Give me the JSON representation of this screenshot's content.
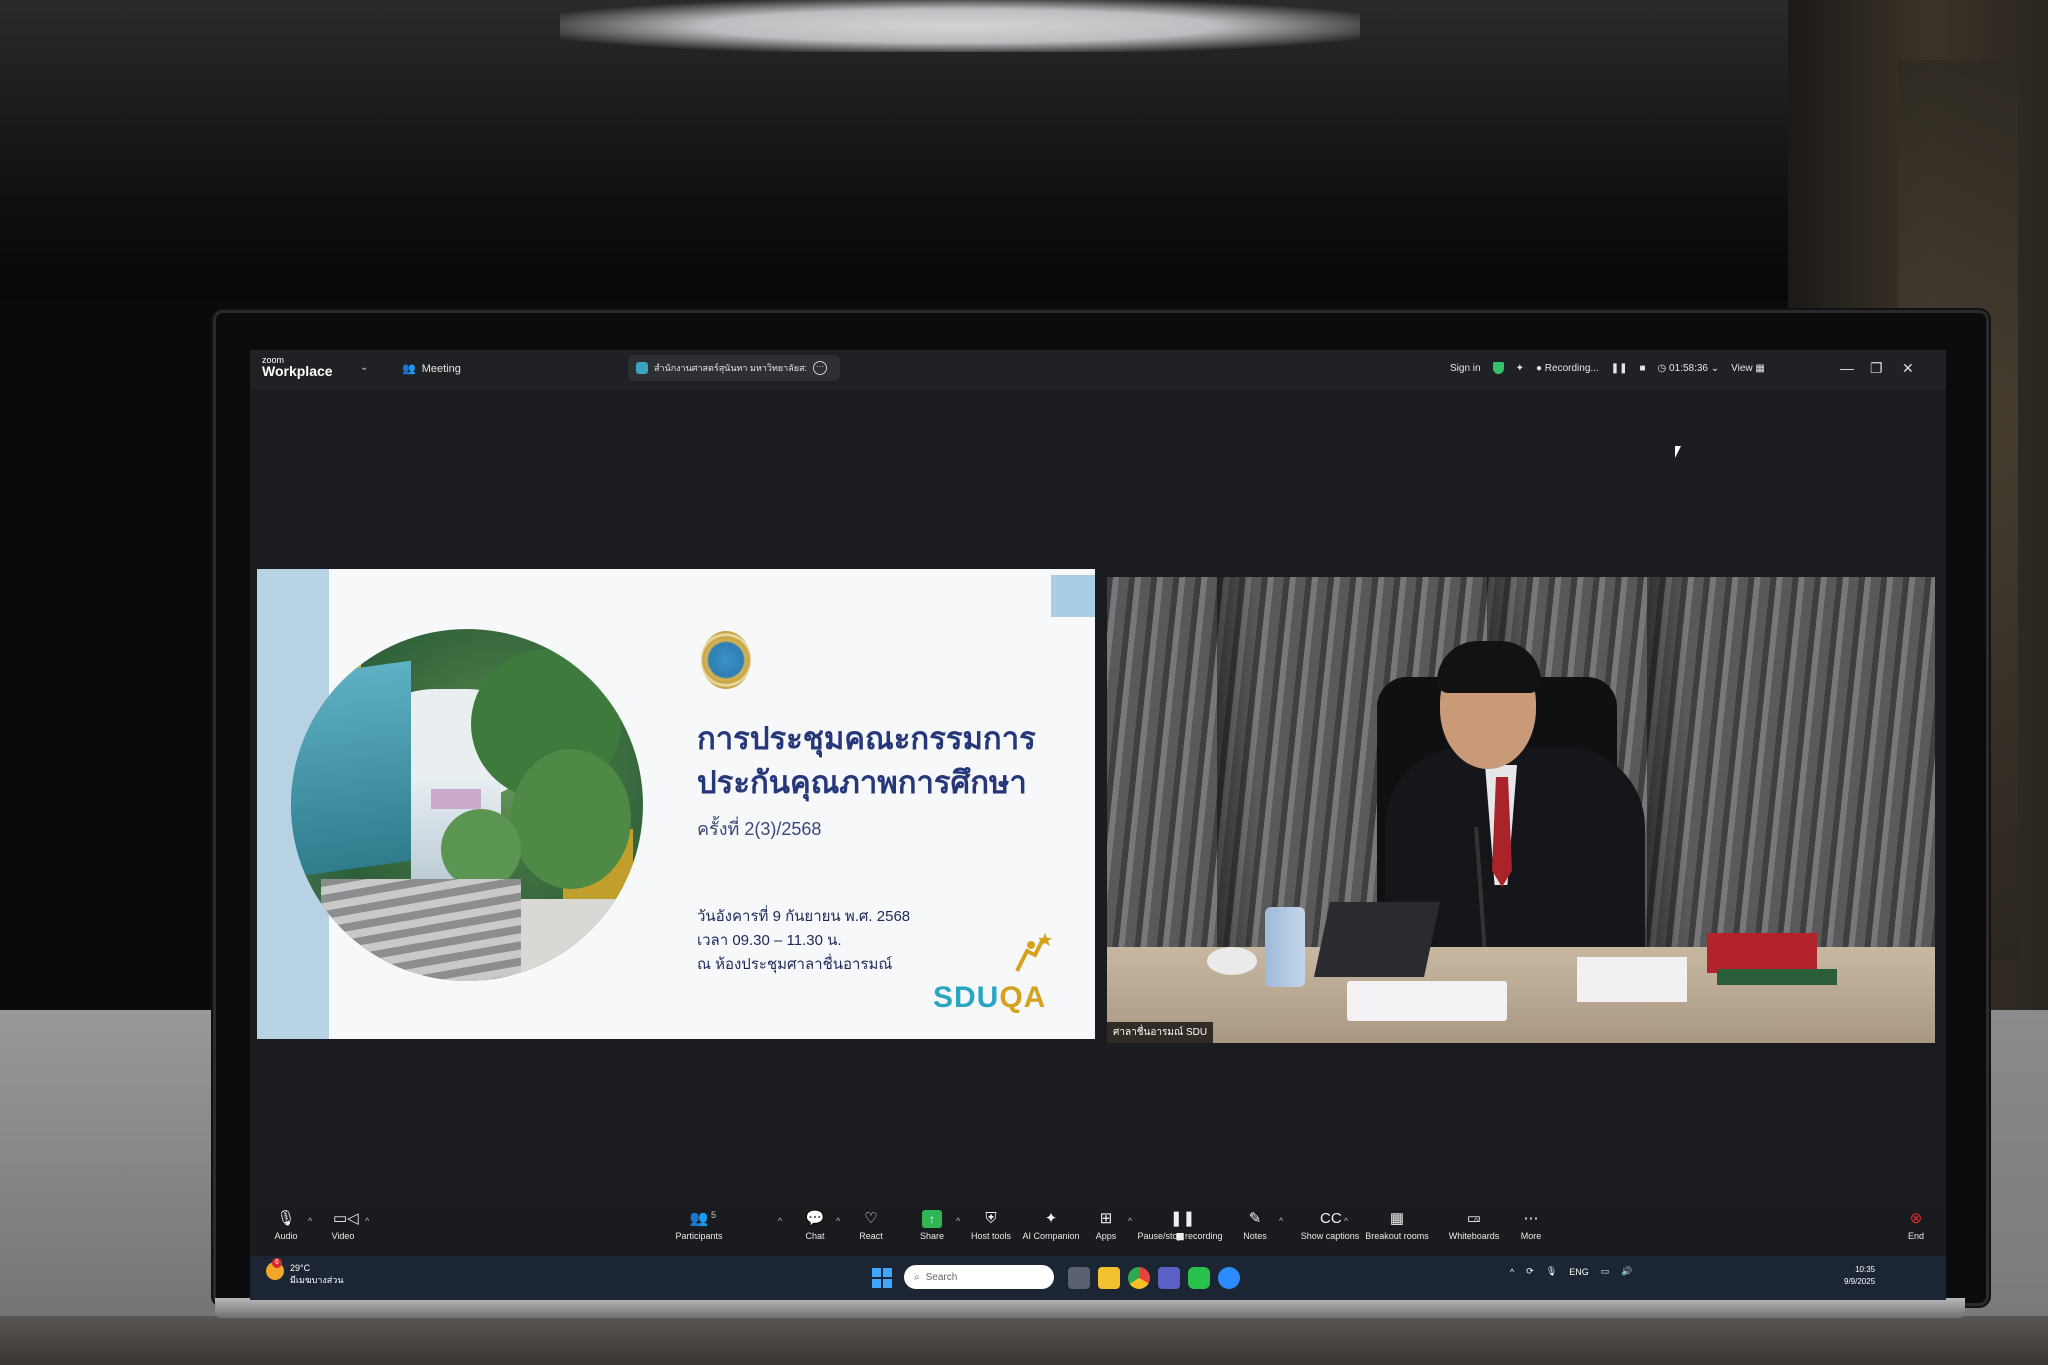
{
  "zoom_bar": {
    "logo_top": "zoom",
    "logo_main": "Workplace",
    "meeting_label": "Meeting",
    "tab_title": "สำนักงานศาสตร์สุนันทา มหาวิทยาลัยส:",
    "sign_in": "Sign in",
    "recording": "Recording...",
    "timer": "01:58:36",
    "view": "View"
  },
  "slide": {
    "title_line1": "การประชุมคณะกรรมการ",
    "title_line2": "ประกันคุณภาพการศึกษา",
    "session": "ครั้งที่ 2(3)/2568",
    "date": "วันอังคารที่ 9 กันยายน พ.ศ. 2568",
    "time": "เวลา 09.30 – 11.30 น.",
    "place": "ณ ห้องประชุมศาลาชื่นอารมณ์",
    "brand_sdu": "SDU",
    "brand_qa": "QA"
  },
  "video": {
    "participant_name": "ศาลาชื่นอารมณ์ SDU"
  },
  "toolbar": {
    "audio": "Audio",
    "video": "Video",
    "participants": "Participants",
    "participants_count": "5",
    "chat": "Chat",
    "react": "React",
    "share": "Share",
    "host_tools": "Host tools",
    "ai_companion": "AI Companion",
    "apps": "Apps",
    "pause_recording": "Pause/stop recording",
    "notes": "Notes",
    "show_captions": "Show captions",
    "breakout_rooms": "Breakout rooms",
    "whiteboards": "Whiteboards",
    "more": "More",
    "end": "End"
  },
  "taskbar": {
    "weather_temp": "29°C",
    "weather_desc": "มีเมฆบางส่วน",
    "weather_badge": "6",
    "search_placeholder": "Search",
    "lang": "ENG",
    "time": "10:35",
    "date": "9/9/2025"
  },
  "colors": {
    "slide_title": "#27387a",
    "sdu": "#2aa6c3",
    "qa": "#d5a21e",
    "share_green": "#2fb553",
    "end_red": "#e02b2b"
  }
}
